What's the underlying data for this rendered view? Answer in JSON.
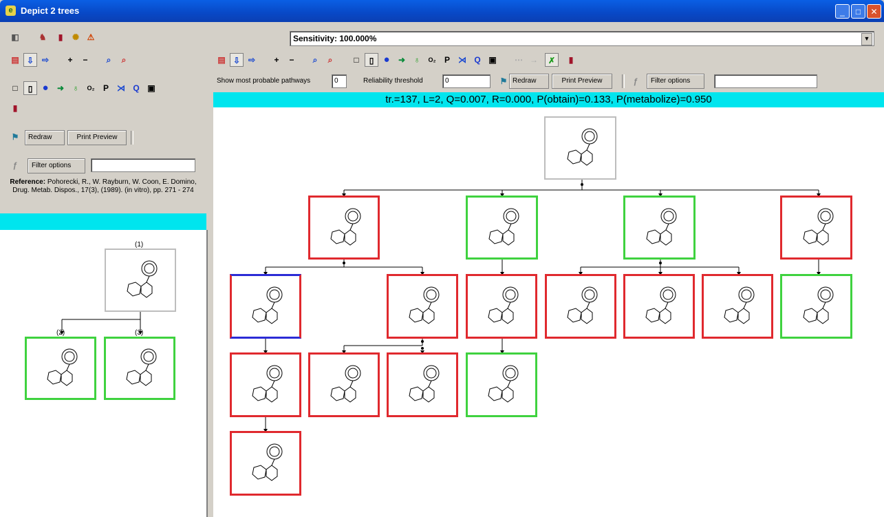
{
  "window": {
    "title": "Depict 2 trees"
  },
  "sensitivity": {
    "value": "Sensitivity: 100.000%"
  },
  "left_panel": {
    "redraw_label": "Redraw",
    "print_preview_label": "Print Preview",
    "filter_options_label": "Filter options",
    "reference_bold": "Reference:",
    "reference_text": "Pohorecki, R., W. Rayburn, W. Coon, E. Domino, Drug. Metab. Dispos., 17(3), (1989). (in vitro), pp. 271 - 274",
    "tree_labels": [
      "(1)",
      "(2)",
      "(3)"
    ]
  },
  "right_panel": {
    "show_pathways_label": "Show most probable pathways",
    "show_pathways_value": "0",
    "reliability_label": "Reliability threshold",
    "reliability_value": "0",
    "redraw_label": "Redraw",
    "print_preview_label": "Print Preview",
    "filter_options_label": "Filter options",
    "status": "tr.=137, L=2, Q=0.007, R=0.000, P(obtain)=0.133, P(metabolize)=0.950"
  },
  "toolbar_glyphs": {
    "plus": "+",
    "minus": "−",
    "p": "P",
    "q": "Q"
  },
  "colors": {
    "predicted": "#e0292e",
    "observed": "#3fd23f",
    "root": "#bdbdbd",
    "status_bar": "#00e5ee",
    "selected": "#2b2bd6"
  }
}
